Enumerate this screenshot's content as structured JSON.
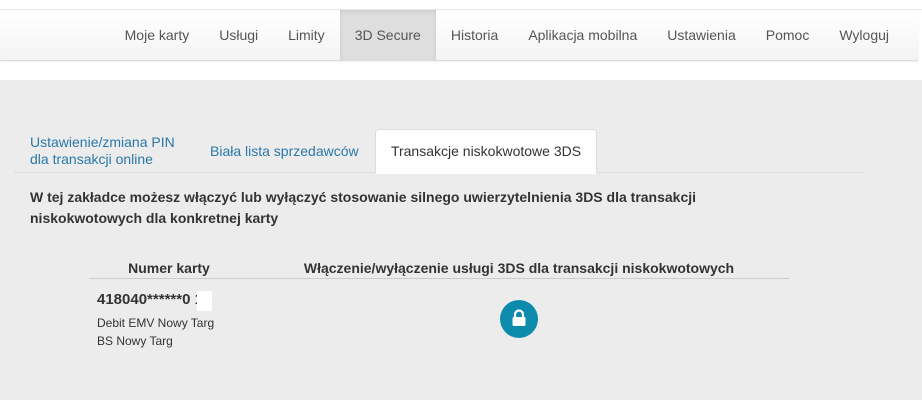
{
  "nav": {
    "items": [
      "Moje karty",
      "Usługi",
      "Limity",
      "3D Secure",
      "Historia",
      "Aplikacja mobilna",
      "Ustawienia",
      "Pomoc",
      "Wyloguj"
    ],
    "active_index": 3
  },
  "tabs": {
    "pin_line1": "Ustawienie/zmiana PIN",
    "pin_line2": "dla transakcji online",
    "whitelist": "Biała lista sprzedawców",
    "lowvalue": "Transakcje niskokwotowe 3DS"
  },
  "description": {
    "line1": "W tej zakładce możesz włączyć lub wyłączyć stosowanie silnego uwierzytelnienia 3DS dla transakcji",
    "line2": "niskokwotowych dla konkretnej karty"
  },
  "table": {
    "col_card": "Numer karty",
    "col_toggle": "Włączenie/wyłączenie usługi 3DS dla transakcji niskokwotowych",
    "rows": [
      {
        "card_number": "418040******0 1",
        "card_name": "Debit EMV Nowy Targ",
        "bank": "BS Nowy Targ",
        "lock_icon": "lock-icon"
      }
    ]
  },
  "colors": {
    "accent": "#0c8bad",
    "link": "#2a78a8",
    "active_nav": "#dedede",
    "content_bg": "#ececec"
  }
}
